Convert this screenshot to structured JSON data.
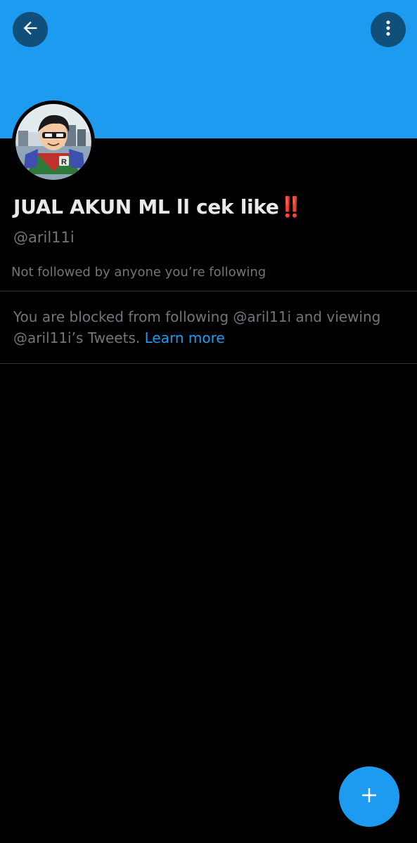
{
  "header": {
    "back_icon": "arrow-left-icon",
    "more_icon": "more-vertical-icon"
  },
  "profile": {
    "display_name": "JUAL AKUN ML ll cek like",
    "display_name_emoji": "‼️",
    "handle": "@aril11i",
    "followed_by": "Not followed by anyone you’re following",
    "avatar_icon": "cartoon-robin-avatar"
  },
  "blocked": {
    "message": "You are blocked from following @aril11i and viewing @aril11i’s Tweets.",
    "learn_more": "Learn more"
  },
  "fab": {
    "icon": "plus-icon"
  },
  "colors": {
    "banner": "#1d9bf0",
    "accent": "#1d9bf0",
    "background": "#000000",
    "primary_text": "#e7e9ea",
    "secondary_text": "#71767b",
    "divider": "#2f3336"
  }
}
